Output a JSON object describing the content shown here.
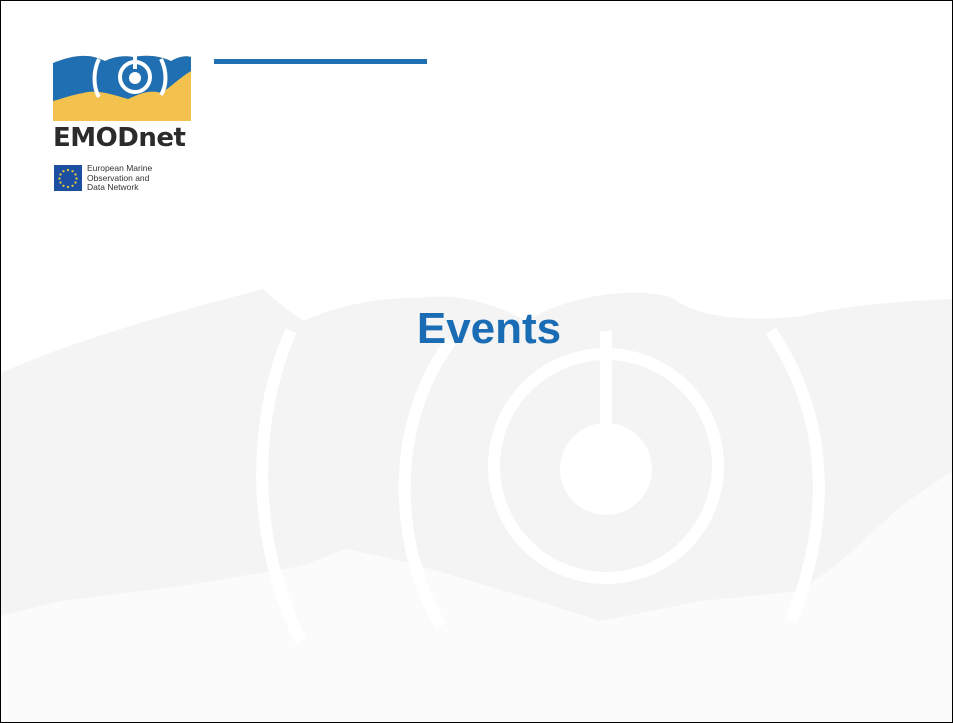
{
  "slide": {
    "title": "Events"
  },
  "logo": {
    "wordmark": "EMODnet",
    "tagline": [
      "European Marine",
      "Observation and",
      "Data Network"
    ],
    "colors": {
      "blue": "#1f6fb2",
      "yellow": "#f2c14e",
      "flag": "#1c4fa1",
      "stars": "#f3d230"
    }
  },
  "theme": {
    "accent": "#1a6db5",
    "watermark": "#f3f3f3"
  }
}
